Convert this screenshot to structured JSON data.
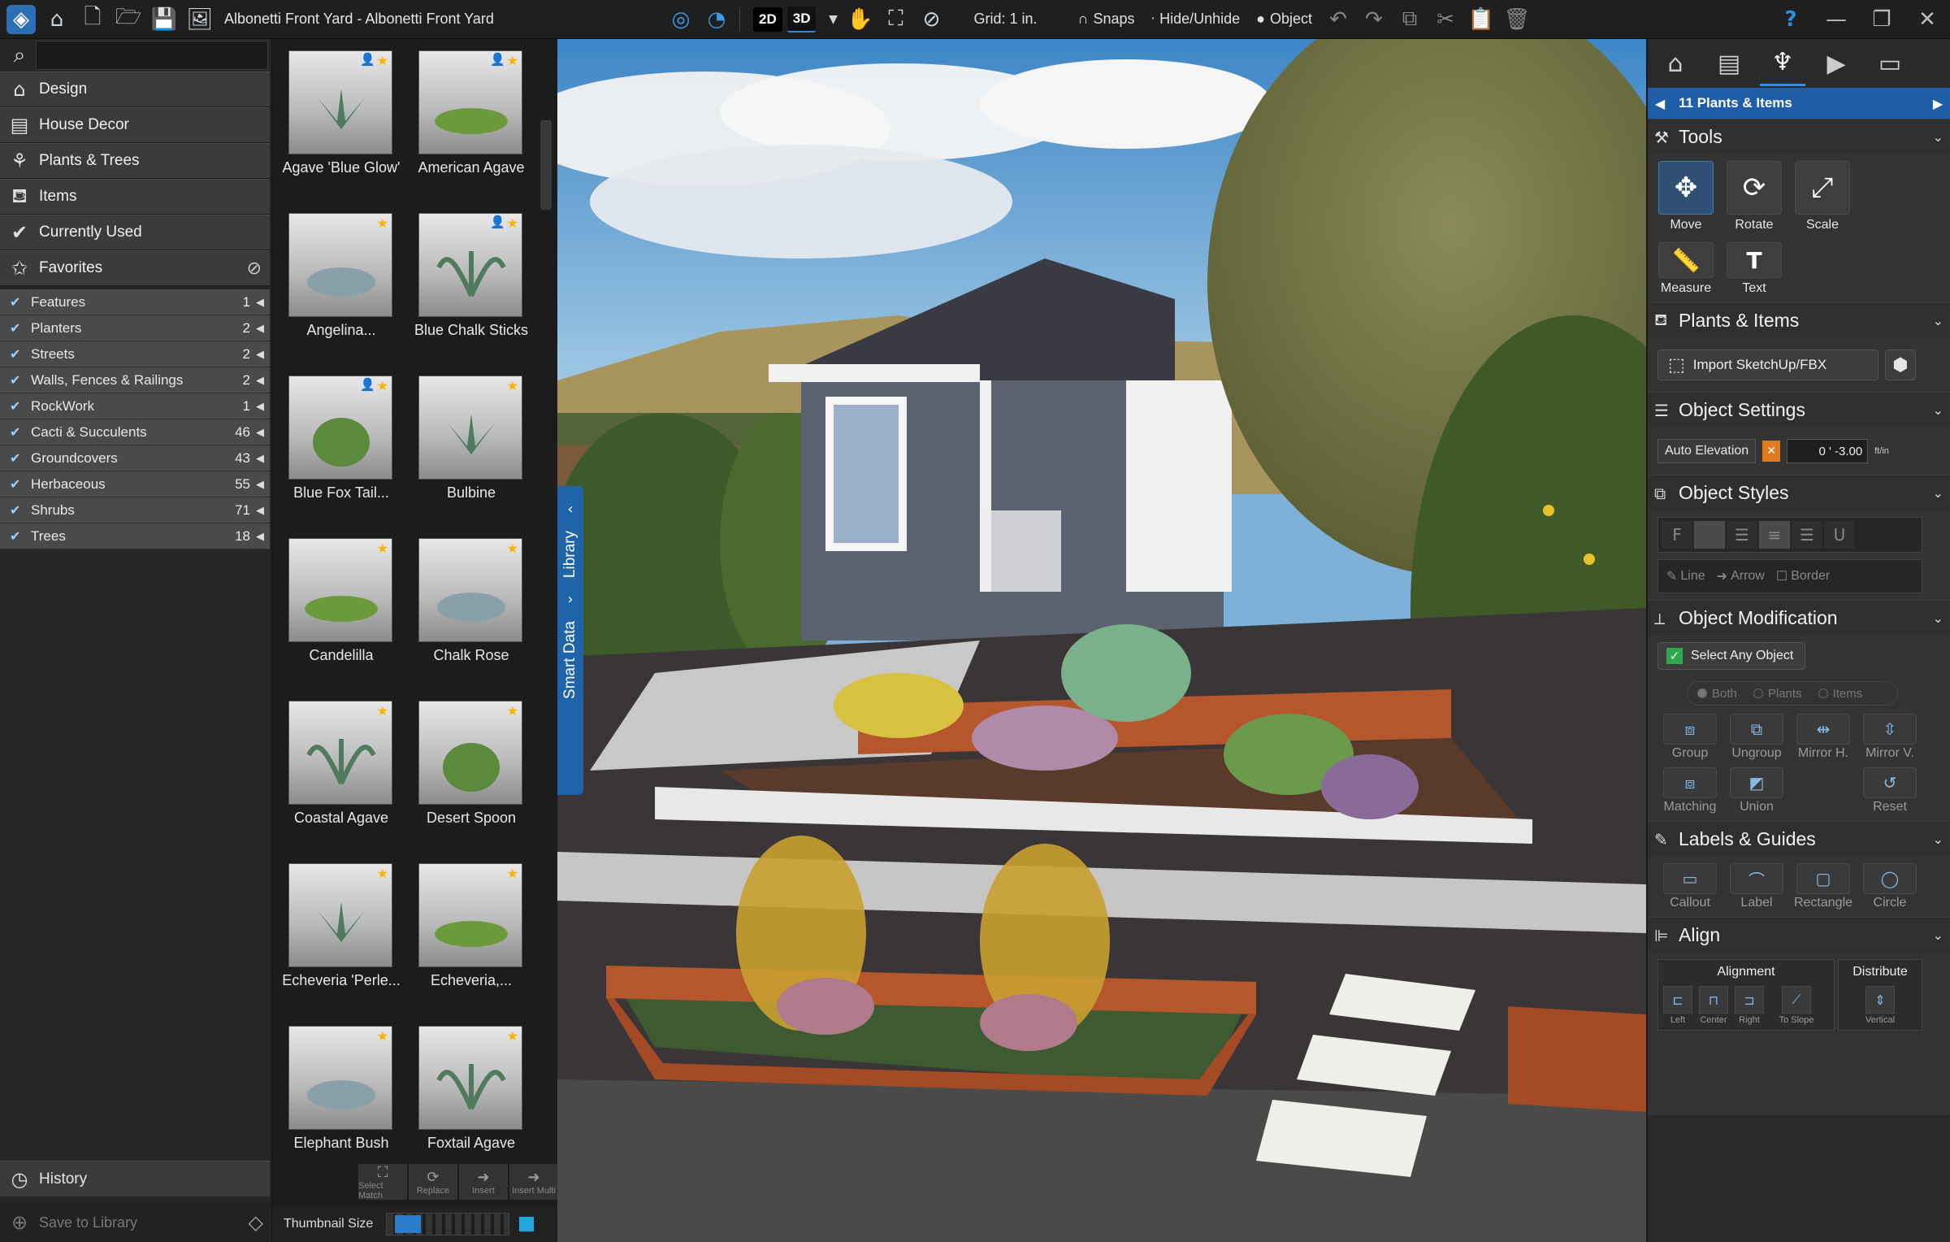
{
  "app": {
    "title": "Albonetti Front Yard - Albonetti Front Yard",
    "mode_2d": "2D",
    "mode_3d": "3D",
    "grid_label": "Grid: 1 in.",
    "snaps_label": "Snaps",
    "hide_label": "Hide/Unhide",
    "object_label": "Object",
    "help": "?"
  },
  "leftnav": {
    "categories": [
      {
        "label": "Design",
        "icon": "house-outline-icon"
      },
      {
        "label": "House Decor",
        "icon": "cabinet-icon"
      },
      {
        "label": "Plants & Trees",
        "icon": "potted-plant-icon"
      },
      {
        "label": "Items",
        "icon": "bench-icon"
      },
      {
        "label": "Currently Used",
        "icon": "check-circle-icon"
      },
      {
        "label": "Favorites",
        "icon": "star-badge-icon"
      }
    ],
    "filters": [
      {
        "label": "Features",
        "count": "1"
      },
      {
        "label": "Planters",
        "count": "2"
      },
      {
        "label": "Streets",
        "count": "2"
      },
      {
        "label": "Walls, Fences & Railings",
        "count": "2"
      },
      {
        "label": "RockWork",
        "count": "1"
      },
      {
        "label": "Cacti & Succulents",
        "count": "46"
      },
      {
        "label": "Groundcovers",
        "count": "43"
      },
      {
        "label": "Herbaceous",
        "count": "55"
      },
      {
        "label": "Shrubs",
        "count": "71"
      },
      {
        "label": "Trees",
        "count": "18"
      }
    ],
    "history": "History",
    "save_to_library": "Save to Library"
  },
  "library": {
    "items": [
      {
        "label": "Agave 'Blue Glow'",
        "user": true
      },
      {
        "label": "American Agave",
        "user": true
      },
      {
        "label": "Angelina...",
        "user": false
      },
      {
        "label": "Blue Chalk Sticks",
        "user": true
      },
      {
        "label": "Blue Fox Tail...",
        "user": true
      },
      {
        "label": "Bulbine",
        "user": false
      },
      {
        "label": "Candelilla",
        "user": false
      },
      {
        "label": "Chalk Rose",
        "user": false
      },
      {
        "label": "Coastal Agave",
        "user": false
      },
      {
        "label": "Desert Spoon",
        "user": false
      },
      {
        "label": "Echeveria 'Perle...",
        "user": false
      },
      {
        "label": "Echeveria,...",
        "user": false
      },
      {
        "label": "Elephant Bush",
        "user": false
      },
      {
        "label": "Foxtail Agave",
        "user": false
      }
    ],
    "bottom_buttons": [
      "Select Match",
      "Replace",
      "Insert",
      "Insert Multi"
    ],
    "thumbnail_size": "Thumbnail Size"
  },
  "viewport": {
    "tab_library": "Library",
    "tab_smart_data": "Smart Data"
  },
  "rightpanel": {
    "nav_title": "11 Plants & Items",
    "tools": {
      "title": "Tools",
      "items": [
        "Move",
        "Rotate",
        "Scale"
      ],
      "items2": [
        "Measure",
        "Text"
      ]
    },
    "plants_items": {
      "title": "Plants & Items",
      "import_label": "Import SketchUp/FBX"
    },
    "object_settings": {
      "title": "Object Settings",
      "auto_elevation": "Auto Elevation",
      "elevation_value": "0 ' -3.00",
      "unit": "ft/in"
    },
    "object_styles": {
      "title": "Object Styles",
      "line": "Line",
      "arrow": "Arrow",
      "border": "Border"
    },
    "object_modification": {
      "title": "Object Modification",
      "select_any": "Select Any Object",
      "radio": [
        "Both",
        "Plants",
        "Items"
      ],
      "buttons": [
        "Group",
        "Ungroup",
        "Mirror H.",
        "Mirror V.",
        "Matching",
        "Union",
        "",
        "Reset"
      ]
    },
    "labels_guides": {
      "title": "Labels & Guides",
      "buttons": [
        "Callout",
        "Label",
        "Rectangle",
        "Circle"
      ]
    },
    "align": {
      "title": "Align",
      "alignment": "Alignment",
      "distribute": "Distribute",
      "buttons": [
        "Left",
        "Center",
        "Right",
        "To Slope"
      ],
      "vertical": "Vertical"
    }
  },
  "colors": {
    "accent": "#1e5ea8",
    "star": "#f4b400",
    "user_badge": "#2d8cff"
  }
}
